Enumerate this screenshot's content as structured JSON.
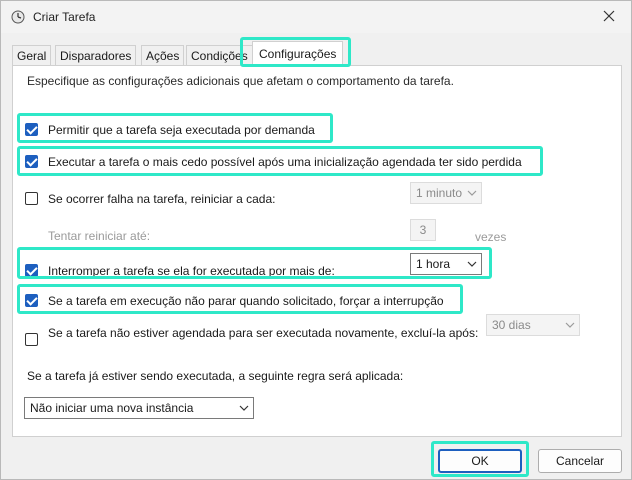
{
  "window": {
    "title": "Criar Tarefa",
    "accent_color": "#1d5fbf",
    "highlight_color": "#2ee8c8"
  },
  "tabs": [
    {
      "label": "Geral"
    },
    {
      "label": "Disparadores"
    },
    {
      "label": "Ações"
    },
    {
      "label": "Condições"
    },
    {
      "label": "Configurações",
      "active": true
    }
  ],
  "settings": {
    "description": "Especifique as configurações adicionais que afetam o comportamento da tarefa.",
    "allow_on_demand": {
      "label": "Permitir que a tarefa seja executada por demanda",
      "checked": true
    },
    "run_asap": {
      "label": "Executar a tarefa o mais cedo possível após uma inicialização agendada ter sido perdida",
      "checked": true
    },
    "restart_on_fail": {
      "label": "Se ocorrer falha na tarefa, reiniciar a cada:",
      "checked": false,
      "interval": "1 minuto"
    },
    "retry": {
      "label": "Tentar reiniciar até:",
      "count": "3",
      "unit": "vezes"
    },
    "stop_if_longer": {
      "label": "Interromper a tarefa se ela for executada por mais de:",
      "checked": true,
      "duration": "1 hora"
    },
    "force_stop": {
      "label": "Se a tarefa em execução não parar quando solicitado, forçar a interrupção",
      "checked": true
    },
    "delete_if_not_scheduled": {
      "label": "Se a tarefa não estiver agendada para ser executada novamente, excluí-la após:",
      "checked": false,
      "duration": "30 dias"
    },
    "rule_label": "Se a tarefa já estiver sendo executada, a seguinte regra será aplicada:",
    "rule_value": "Não iniciar uma nova instância"
  },
  "buttons": {
    "ok": "OK",
    "cancel": "Cancelar"
  }
}
